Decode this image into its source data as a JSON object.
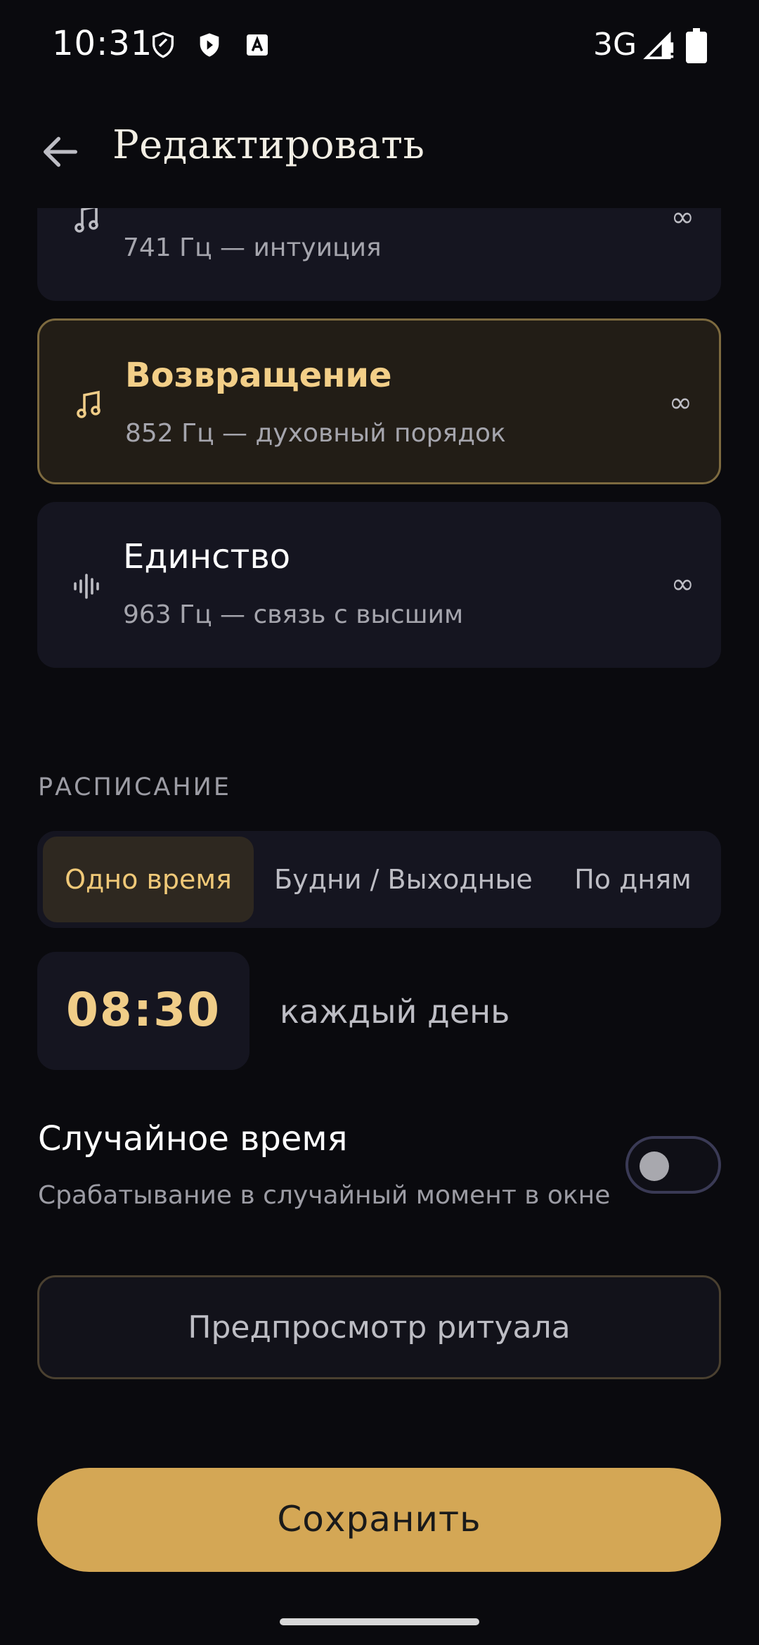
{
  "status_bar": {
    "time": "10:31",
    "network": "3G",
    "icons": [
      "shield-outline-icon",
      "shield-play-icon",
      "font-a-icon",
      "signal-icon",
      "battery-icon"
    ]
  },
  "app_bar": {
    "back_icon": "arrow-left-icon",
    "title": "Редактировать"
  },
  "frequencies": [
    {
      "name": "",
      "description": "741 Гц — интуиция",
      "icon": "music-note-icon",
      "repeat": "∞",
      "selected": false
    },
    {
      "name": "Возвращение",
      "description": "852 Гц — духовный порядок",
      "icon": "music-note-icon",
      "repeat": "∞",
      "selected": true
    },
    {
      "name": "Единство",
      "description": "963 Гц — связь с высшим",
      "icon": "waveform-icon",
      "repeat": "∞",
      "selected": false
    }
  ],
  "schedule": {
    "header": "РАСПИСАНИЕ",
    "tabs": [
      "Одно время",
      "Будни / Выходные",
      "По дням"
    ],
    "active_tab": "Одно время",
    "time": "08:30",
    "caption": "каждый день"
  },
  "random_time": {
    "title": "Случайное время",
    "subtitle": "Срабатывание в случайный момент в окне",
    "enabled": false
  },
  "preview_button": "Предпросмотр ритуала",
  "save_button": "Сохранить",
  "colors": {
    "background": "#0a0a0e",
    "card": "#151520",
    "accent_gold": "#d4a755",
    "accent_text": "#f0cd88",
    "selected_border": "#7d6a3f"
  }
}
